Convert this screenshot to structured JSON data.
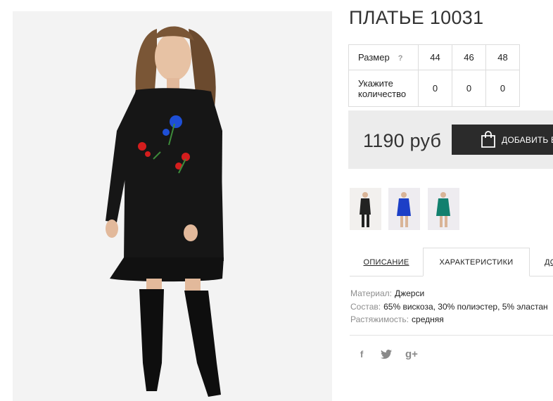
{
  "product": {
    "title": "ПЛАТЬЕ 10031",
    "photo_alt": "product-photo"
  },
  "sizes": {
    "row_size_label": "Размер",
    "help_label": "?",
    "values": [
      "44",
      "46",
      "48"
    ],
    "row_qty_label": "Укажите количество",
    "quantities": [
      "0",
      "0",
      "0"
    ]
  },
  "purchase": {
    "price": "1190 руб",
    "add_button_label": "ДОБАВИТЬ В"
  },
  "thumbnails": [
    {
      "name": "thumb-black"
    },
    {
      "name": "thumb-blue"
    },
    {
      "name": "thumb-green"
    }
  ],
  "tabs": [
    {
      "label": "ОПИСАНИЕ"
    },
    {
      "label": "ХАРАКТЕРИСТИКИ"
    },
    {
      "label": "ДО"
    }
  ],
  "specs": [
    {
      "key": "Материал:",
      "value": "Джерси"
    },
    {
      "key": "Состав:",
      "value": "65% вискоза, 30% полиэстер, 5% эластан"
    },
    {
      "key": "Растяжимость:",
      "value": "средняя"
    }
  ],
  "social": [
    {
      "label": "f",
      "icon": "facebook-icon"
    },
    {
      "label": "twitter",
      "icon": "twitter-icon"
    },
    {
      "label": "g+",
      "icon": "google-plus-icon"
    }
  ],
  "colors": {
    "dress": "#161616",
    "thumb_blue": "#1c3fc7",
    "thumb_green": "#12806e",
    "button": "#2b2b2b",
    "price_bg": "#ececec"
  }
}
